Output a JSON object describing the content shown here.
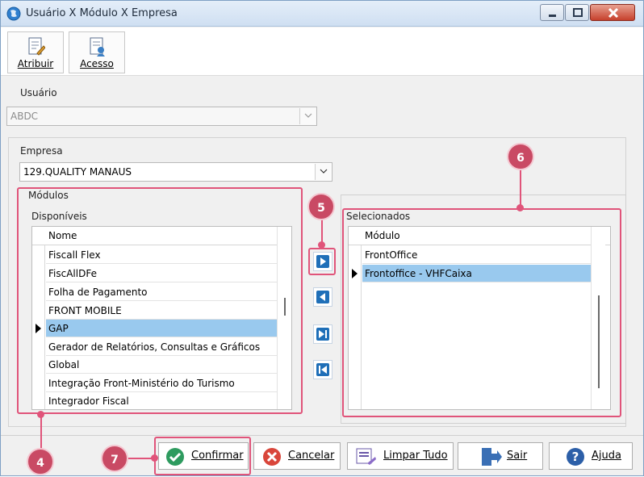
{
  "window": {
    "title": "Usuário X Módulo X Empresa"
  },
  "toolbar": {
    "atribuir_label": "Atribuir",
    "acesso_label": "Acesso"
  },
  "usuario": {
    "label": "Usuário",
    "value": "ABDC"
  },
  "empresa": {
    "label": "Empresa",
    "value": "129.QUALITY MANAUS"
  },
  "modulos": {
    "group_label": "Módulos",
    "disponiveis_label": "Disponíveis",
    "header": "Nome",
    "items": [
      "Fiscall Flex",
      "FiscAllDFe",
      "Folha de Pagamento",
      "FRONT MOBILE",
      "GAP",
      "Gerador de Relatórios, Consultas e Gráficos",
      "Global",
      "Integração Front-Ministério do Turismo",
      "Integrador Fiscal"
    ],
    "selected_index": 4
  },
  "selecionados": {
    "label": "Selecionados",
    "header": "Módulo",
    "items": [
      "FrontOffice",
      "Frontoffice - VHFCaixa"
    ],
    "selected_index": 1
  },
  "buttons": {
    "confirmar": "Confirmar",
    "cancelar": "Cancelar",
    "limpar_tudo": "Limpar Tudo",
    "sair": "Sair",
    "ajuda": "Ajuda"
  },
  "callouts": [
    "4",
    "5",
    "6",
    "7"
  ],
  "colors": {
    "callout": "#c94a64",
    "highlight": "#e0547a",
    "selection": "#99c9ee",
    "arrow_blue": "#1f6fb8"
  }
}
